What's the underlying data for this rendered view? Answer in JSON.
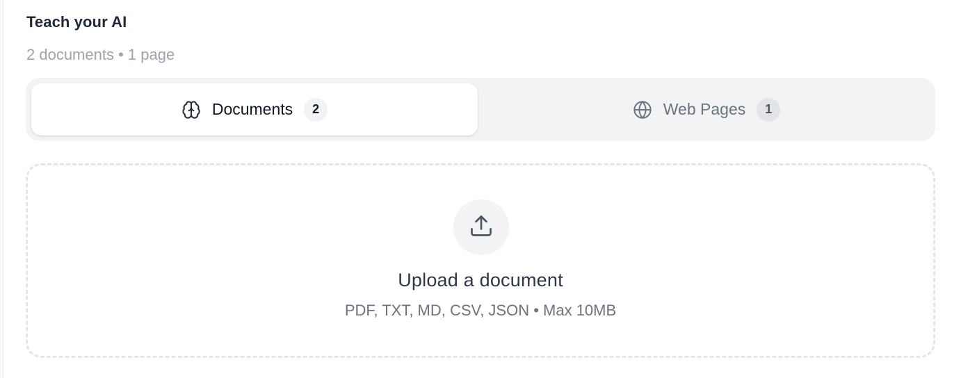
{
  "header": {
    "title": "Teach your AI",
    "subtitle": "2 documents • 1 page"
  },
  "tabs": [
    {
      "label": "Documents",
      "count": "2",
      "icon": "brain-icon",
      "active": true
    },
    {
      "label": "Web Pages",
      "count": "1",
      "icon": "globe-icon",
      "active": false
    }
  ],
  "upload": {
    "icon": "upload-icon",
    "title": "Upload a document",
    "hint": "PDF, TXT, MD, CSV, JSON • Max 10MB"
  },
  "colors": {
    "tab_track": "#f2f3f5",
    "active_tab": "#ffffff",
    "muted_text": "#9ca3af",
    "dropzone_border": "#e4e5e8"
  }
}
